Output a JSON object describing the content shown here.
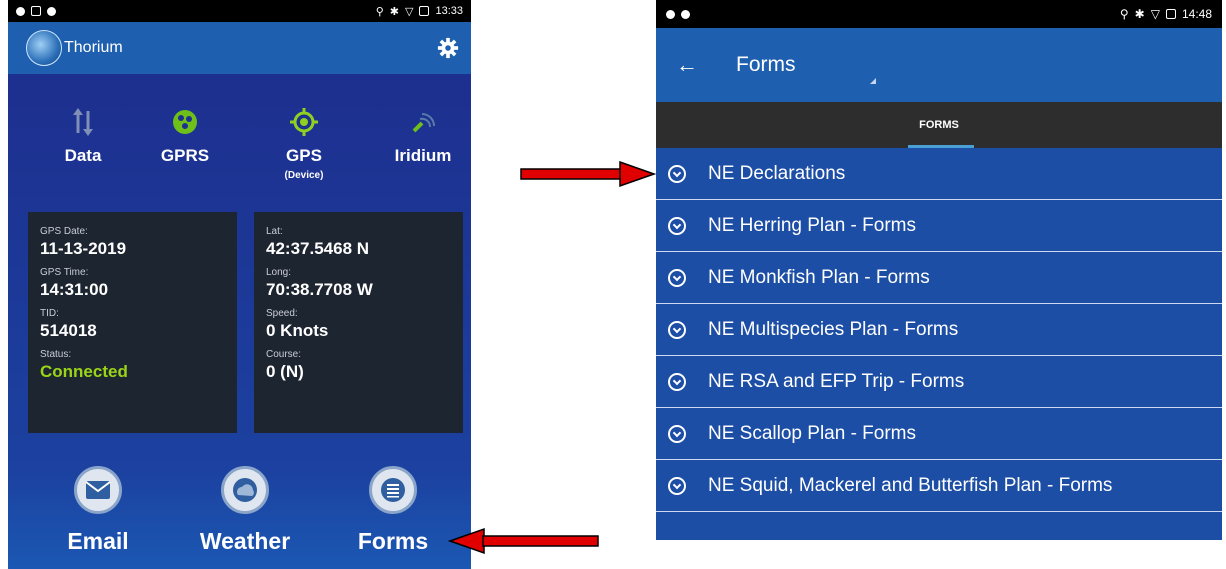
{
  "left_phone": {
    "status_bar": {
      "time": "13:33"
    },
    "app_bar": {
      "title": "Thorium",
      "logo_icon": "thorium-globe-logo",
      "settings_icon": "gear-icon"
    },
    "connections": [
      {
        "label": "Data",
        "sub": "",
        "icon": "data-arrows-icon"
      },
      {
        "label": "GPRS",
        "sub": "",
        "icon": "gprs-icon"
      },
      {
        "label": "GPS",
        "sub": "(Device)",
        "icon": "gps-icon"
      },
      {
        "label": "Iridium",
        "sub": "",
        "icon": "iridium-icon"
      }
    ],
    "left_panel": {
      "gps_date_label": "GPS Date:",
      "gps_date": "11-13-2019",
      "gps_time_label": "GPS Time:",
      "gps_time": "14:31:00",
      "tid_label": "TID:",
      "tid": "514018",
      "status_label": "Status:",
      "status": "Connected"
    },
    "right_panel": {
      "lat_label": "Lat:",
      "lat": "42:37.5468 N",
      "long_label": "Long:",
      "long": "70:38.7708 W",
      "speed_label": "Speed:",
      "speed": "0 Knots",
      "course_label": "Course:",
      "course": "0 (N)"
    },
    "actions": [
      {
        "label": "Email",
        "icon": "envelope-icon"
      },
      {
        "label": "Weather",
        "icon": "weather-icon"
      },
      {
        "label": "Forms",
        "icon": "list-icon"
      }
    ]
  },
  "right_phone": {
    "status_bar": {
      "time": "14:48"
    },
    "app_bar": {
      "title": "Forms",
      "back_icon": "back-arrow-icon"
    },
    "tab": {
      "label": "FORMS"
    },
    "forms": [
      "NE Declarations",
      "NE Herring Plan - Forms",
      "NE Monkfish Plan - Forms",
      "NE Multispecies Plan - Forms",
      "NE RSA and EFP Trip - Forms",
      "NE Scallop Plan - Forms",
      "NE Squid, Mackerel and Butterfish Plan - Forms"
    ]
  },
  "colors": {
    "arrow": "#e00000",
    "status_connected": "#9ad419",
    "app_bar": "#1f5fb0"
  }
}
